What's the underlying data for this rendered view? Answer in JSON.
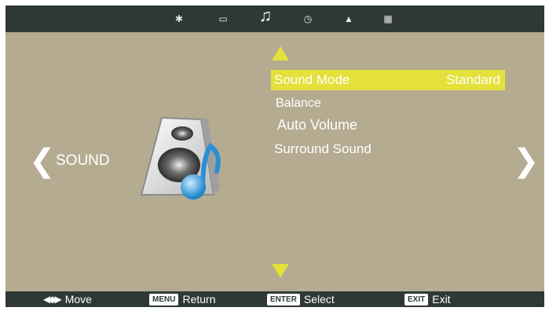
{
  "topbar": {
    "icons": [
      "gear-icon",
      "monitor-icon",
      "music-note-icon",
      "clock-icon",
      "lock-icon",
      "grid-icon"
    ],
    "active": "music-note-icon"
  },
  "category": {
    "label": "SOUND",
    "left_arrow": "❮",
    "right_arrow": "❯"
  },
  "menu": {
    "items": [
      {
        "label": "Sound  Mode",
        "value": "Standard"
      },
      {
        "label": "Balance"
      },
      {
        "label": "Auto Volume"
      },
      {
        "label": "Surround Sound"
      }
    ]
  },
  "hints": {
    "move": "Move",
    "menu_key": "MENU",
    "menu": "Return",
    "enter_key": "ENTER",
    "enter": "Select",
    "exit_key": "EXIT",
    "exit": "Exit"
  },
  "colors": {
    "background": "#b5ab91",
    "bar": "#2e3936",
    "highlight": "#e3e13a"
  }
}
